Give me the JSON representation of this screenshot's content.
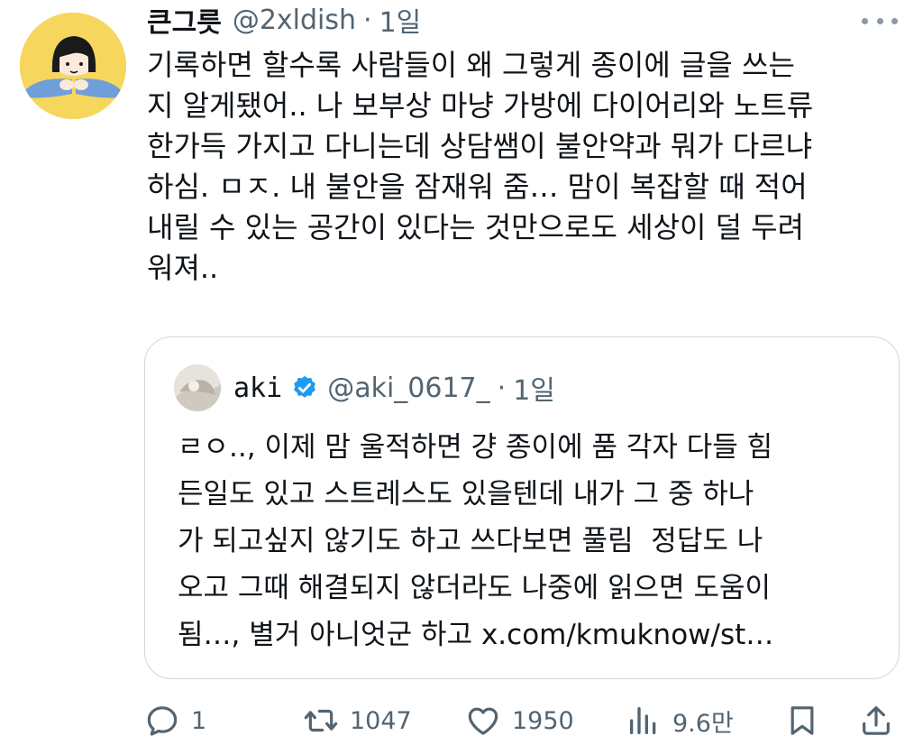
{
  "tweet": {
    "display_name": "큰그릇",
    "handle": "@2xldish",
    "separator": "·",
    "time": "1일",
    "avatar_icon": "cartoon-girl-avatar",
    "text": "기록하면 할수록 사람들이 왜 그렇게 종이에 글을 쓰는\n지 알게됐어.. 나 보부상 마냥 가방에 다이어리와 노트류\n한가득 가지고 다니는데 상담쌤이 불안약과 뭐가 다르냐\n하심. ㅁㅈ. 내 불안을 잠재워 줌… 맘이 복잡할 때 적어\n내릴 수 있는 공간이 있다는 것만으로도 세상이 덜 두려\n워져.."
  },
  "quote": {
    "display_name": "aki",
    "verified": true,
    "handle": "@aki_0617_",
    "separator": "·",
    "time": "1일",
    "avatar_icon": "photo-avatar",
    "text": "ㄹㅇ.., 이제 맘 울적하면 걍 종이에 품 각자 다들 힘\n든일도 있고 스트레스도 있을텐데 내가 그 중 하나\n가 되고싶지 않기도 하고 쓰다보면 풀림  정답도 나\n오고 그때 해결되지 않더라도 나중에 읽으면 도움이\n됨…, 별거 아니엇군 하고 x.com/kmuknow/st…"
  },
  "actions": {
    "reply_count": "1",
    "retweet_count": "1047",
    "like_count": "1950",
    "views_count": "9.6만"
  },
  "colors": {
    "text": "#0f1419",
    "secondary": "#536471",
    "border": "#cfd9de",
    "verified": "#1d9bf0",
    "avatar_bg": "#f7d65e"
  }
}
